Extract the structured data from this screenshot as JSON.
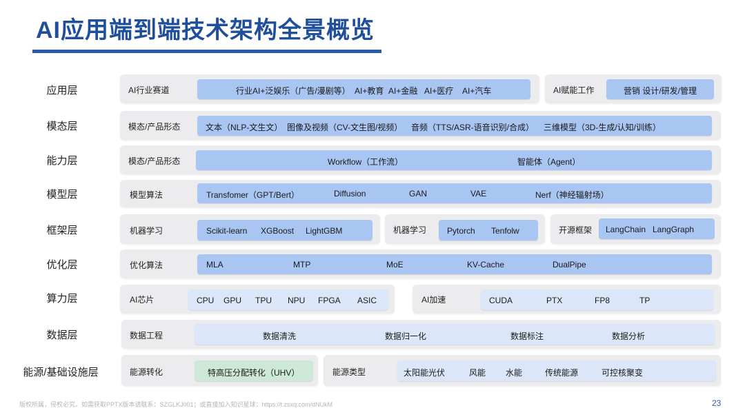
{
  "title": "AI应用端到端技术架构全景概览",
  "layers": {
    "app": "应用层",
    "modal": "模态层",
    "capability": "能力层",
    "model": "模型层",
    "framework": "框架层",
    "optimize": "优化层",
    "compute": "算力层",
    "data": "数据层",
    "energy": "能源/基础设施层"
  },
  "row_app": {
    "label": "AI行业赛道",
    "items": [
      "行业AI+泛娱乐（广告/漫剧等）",
      "AI+教育",
      "AI+金融",
      "AI+医疗",
      "AI+汽车"
    ],
    "label2": "AI赋能工作",
    "items2": [
      "营销 设计/研发/管理"
    ]
  },
  "row_modal": {
    "label": "模态/产品形态",
    "items": [
      "文本（NLP-文生文）",
      "图像及视频（CV-文生图/视频）",
      "音频（TTS/ASR-语音识别/合成）",
      "三维模型（3D-生成/认知/训练）"
    ]
  },
  "row_capability": {
    "label": "模态/产品形态",
    "items": [
      "Workflow（工作流）",
      "智能体（Agent）"
    ]
  },
  "row_model": {
    "label": "模型算法",
    "items": [
      "Transfomer（GPT/Bert）",
      "Diffusion",
      "GAN",
      "VAE",
      "Nerf（神经辐射场）"
    ]
  },
  "row_framework": {
    "label": "机器学习",
    "items": [
      "Scikit-learn",
      "XGBoost",
      "LightGBM"
    ],
    "label2": "机器学习",
    "items2": [
      "Pytorch",
      "Tenfolw"
    ],
    "label3": "开源框架",
    "items3": [
      "LangChain",
      "LangGraph"
    ]
  },
  "row_optimize": {
    "label": "优化算法",
    "items": [
      "MLA",
      "MTP",
      "MoE",
      "KV-Cache",
      "DualPipe"
    ]
  },
  "row_compute": {
    "label": "AI芯片",
    "items": [
      "CPU",
      "GPU",
      "TPU",
      "NPU",
      "FPGA",
      "ASIC"
    ],
    "label2": "AI加速",
    "items2": [
      "CUDA",
      "PTX",
      "FP8",
      "TP"
    ]
  },
  "row_data": {
    "label": "数据工程",
    "items": [
      "数据清洗",
      "数据归一化",
      "数据标注",
      "数据分析"
    ]
  },
  "row_energy": {
    "label": "能源转化",
    "items": [
      "特高压分配转化（UHV）"
    ],
    "label2": "能源类型",
    "items2": [
      "太阳能光伏",
      "风能",
      "水能",
      "传统能源",
      "可控核聚变"
    ]
  },
  "footer": "版权所属，侵权必究。如需获取PPTX版本请联系：SZGLKJ001；或直接加入知识星球：https://t.zsxq.com/dNUkM",
  "page_number": "23",
  "colors": {
    "title": "#1f4f9a",
    "rule": "#2a5aa8",
    "bar": "#a9c5f2",
    "bar_light": "#dbe7f8",
    "bar_green": "#cde8d6",
    "panel": "#ececef"
  }
}
